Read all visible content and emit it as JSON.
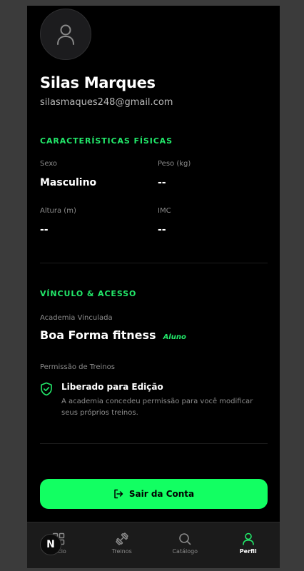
{
  "profile": {
    "name": "Silas Marques",
    "email": "silasmaques248@gmail.com"
  },
  "physical": {
    "title": "CARACTERÍSTICAS FÍSICAS",
    "sex_label": "Sexo",
    "sex_value": "Masculino",
    "weight_label": "Peso (kg)",
    "weight_value": "--",
    "height_label": "Altura (m)",
    "height_value": "--",
    "bmi_label": "IMC",
    "bmi_value": "--"
  },
  "link": {
    "title": "VÍNCULO & ACESSO",
    "gym_label": "Academia Vinculada",
    "gym_name": "Boa Forma fitness",
    "gym_role": "Aluno",
    "permission_label": "Permissão de Treinos",
    "permission_title": "Liberado para Edição",
    "permission_desc": "A academia concedeu permissão para você modificar seus próprios treinos."
  },
  "actions": {
    "logout_label": "Sair da Conta"
  },
  "tabbar": {
    "items": [
      {
        "label": "Início",
        "icon": "grid-icon"
      },
      {
        "label": "Treinos",
        "icon": "dumbbell-icon"
      },
      {
        "label": "Catálogo",
        "icon": "search-icon"
      },
      {
        "label": "Perfil",
        "icon": "user-icon",
        "active": true
      }
    ]
  },
  "fab": {
    "letter": "N"
  },
  "colors": {
    "accent": "#22e86a",
    "button": "#12ff62",
    "background": "#000000",
    "tabbar": "#1b1b1b"
  }
}
